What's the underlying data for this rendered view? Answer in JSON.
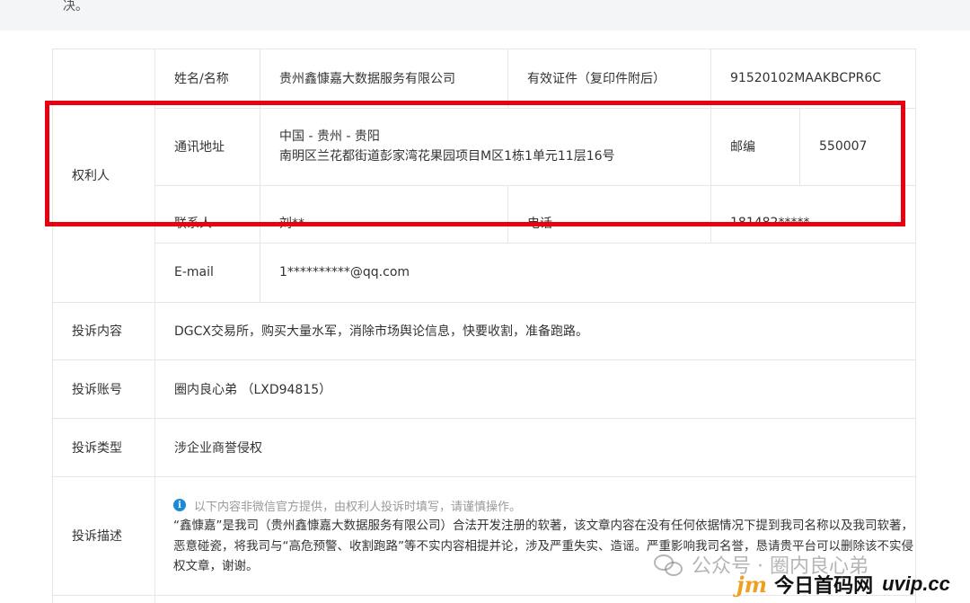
{
  "top_text": "决。",
  "owner": {
    "section_label": "权利人",
    "name_label": "姓名/名称",
    "name_value": "贵州鑫慷嘉大数据服务有限公司",
    "id_label": "有效证件（复印件附后）",
    "id_value": "91520102MAAKBCPR6C",
    "address_label": "通讯地址",
    "address_line1": "中国 - 贵州 - 贵阳",
    "address_line2": "南明区兰花都街道彭家湾花果园项目M区1栋1单元11层16号",
    "postcode_label": "邮编",
    "postcode_value": "550007",
    "contact_label": "联系人",
    "contact_value": "刘**",
    "phone_label": "电话",
    "phone_value": "181482*****",
    "email_label": "E-mail",
    "email_value": "1**********@qq.com"
  },
  "complaint_content": {
    "label": "投诉内容",
    "value": "DGCX交易所，购买大量水军，消除市场舆论信息，快要收割，准备跑路。"
  },
  "complaint_account": {
    "label": "投诉账号",
    "value": "圈内良心弟 （LXD94815）"
  },
  "complaint_type": {
    "label": "投诉类型",
    "value": "涉企业商誉侵权"
  },
  "complaint_description": {
    "label": "投诉描述",
    "notice": "以下内容非微信官方提供，由权利人投诉时填写，请谨慎操作。",
    "text": "“鑫慷嘉”是我司（贵州鑫慷嘉大数据服务有限公司）合法开发注册的软著，该文章内容在没有任何依据情况下提到我司名称以及我司软著，恶意碰瓷，将我司与“高危预警、收割跑路”等不实内容相提并论，涉及严重失实、造谣。严重影响我司名誉，恳请贵平台可以删除该不实侵权文章，谢谢。"
  },
  "watermark": {
    "text": "公众号 · 圈内良心弟"
  },
  "brand": {
    "logo_text": "jm",
    "name": "今日首码网",
    "site": "uvip.cc"
  },
  "colors": {
    "highlight_border": "#e60012",
    "info_icon": "#1b8ad8",
    "grid_line": "#e6e6e6"
  }
}
